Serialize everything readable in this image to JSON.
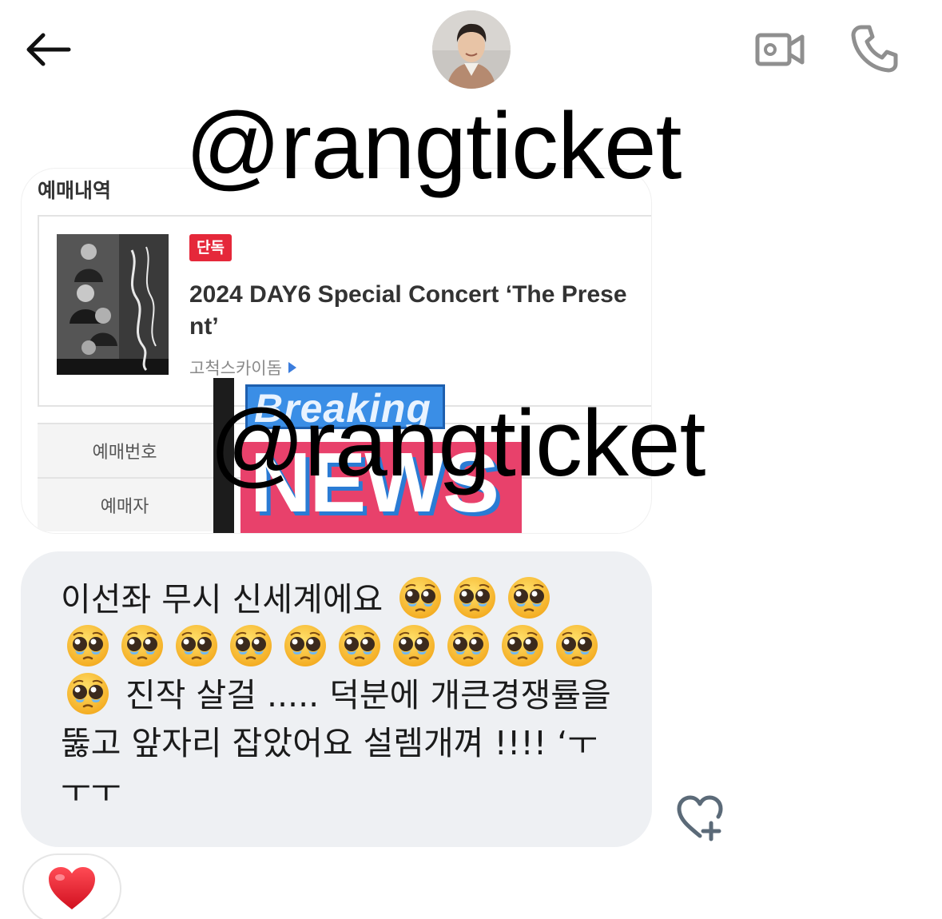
{
  "header": {
    "back_icon": "arrow-left-icon",
    "video_icon": "video-camera-icon",
    "call_icon": "phone-icon"
  },
  "watermarks": [
    "@rangticket",
    "@rangticket"
  ],
  "shared_screenshot": {
    "heading": "예매내역",
    "badge": "단독",
    "concert_title": "2024 DAY6 Special Concert ‘The Present’",
    "venue": "고척스카이돔",
    "rows": [
      {
        "label": "예매번호"
      },
      {
        "label": "예매자"
      }
    ],
    "news_graphic": {
      "top": "Breaking",
      "bottom": "NEWS"
    }
  },
  "message": {
    "text_before": "이선좌 무시 신세계에요",
    "text_after": "진작 살걸 ..... 덕분에 개큰경쟁률을 뚫고 앞자리 잡았어요 설렘개껴 !!!! ‘ㅜㅜㅜ",
    "emoji_icon": "pleading-face-emoji",
    "emoji_count_before": 3,
    "emoji_count_middle": 11
  },
  "reaction": {
    "emoji": "❤️",
    "icon": "red-heart-icon"
  },
  "colors": {
    "bubble_bg": "#eef0f3",
    "badge_red": "#e5283a",
    "icon_gray": "#8f8f8f"
  }
}
